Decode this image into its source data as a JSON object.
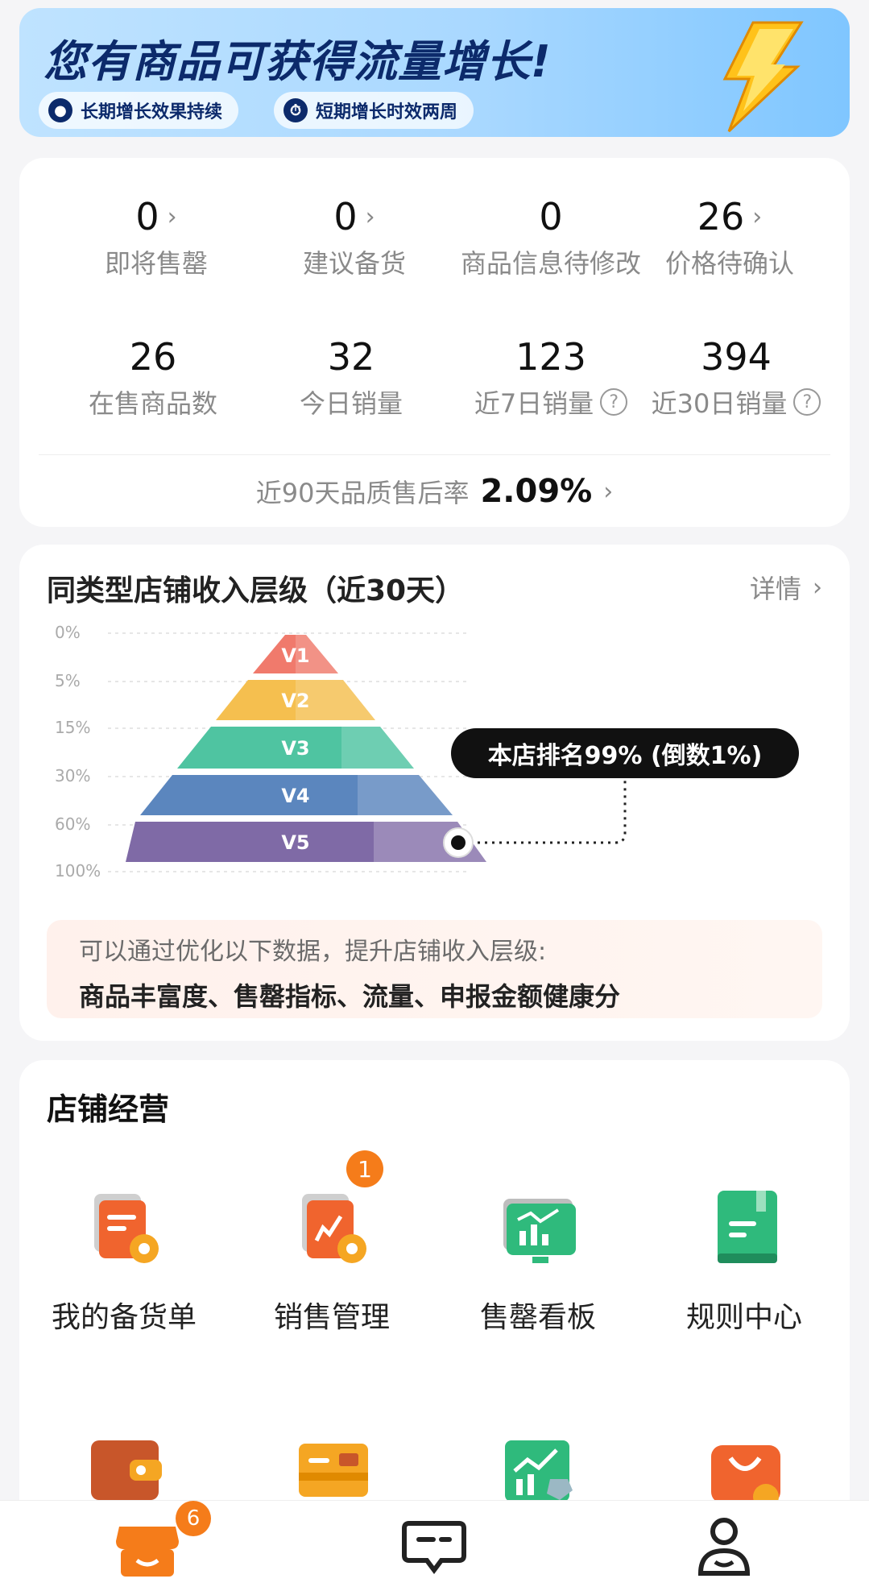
{
  "banner": {
    "title": "您有商品可获得流量增长!",
    "chips": [
      {
        "label": "长期增长效果持续",
        "icon": "globe-icon"
      },
      {
        "label": "短期增长时效两周",
        "icon": "timer-icon"
      }
    ]
  },
  "stats": {
    "row1": [
      {
        "value": "0",
        "label": "即将售罄",
        "has_arrow": true
      },
      {
        "value": "0",
        "label": "建议备货",
        "has_arrow": true
      },
      {
        "value": "0",
        "label": "商品信息待修改",
        "has_arrow": false
      },
      {
        "value": "26",
        "label": "价格待确认",
        "has_arrow": true
      }
    ],
    "row2": [
      {
        "value": "26",
        "label": "在售商品数"
      },
      {
        "value": "32",
        "label": "今日销量"
      },
      {
        "value": "123",
        "label": "近7日销量",
        "help": true
      },
      {
        "value": "394",
        "label": "近30日销量",
        "help": true
      }
    ],
    "after_sale_label": "近90天品质售后率",
    "after_sale_value": "2.09%"
  },
  "pyramid": {
    "title": "同类型店铺收入层级（近30天）",
    "detail_label": "详情",
    "y_labels": [
      "0%",
      "5%",
      "15%",
      "30%",
      "60%",
      "100%"
    ],
    "levels": [
      "V1",
      "V2",
      "V3",
      "V4",
      "V5"
    ],
    "level_colors": [
      "#f07a6c",
      "#f5bf4f",
      "#4fc4a1",
      "#5b86be",
      "#7f6aa6"
    ],
    "tip": "本店排名99% (倒数1%)",
    "hint_line1": "可以通过优化以下数据，提升店铺收入层级:",
    "hint_line2": "商品丰富度、售罄指标、流量、申报金额健康分"
  },
  "operations": {
    "title": "店铺经营",
    "items": [
      {
        "label": "我的备货单",
        "icon": "stock-order-icon"
      },
      {
        "label": "销售管理",
        "icon": "sales-management-icon",
        "badge": "1"
      },
      {
        "label": "售罄看板",
        "icon": "sellout-dashboard-icon"
      },
      {
        "label": "规则中心",
        "icon": "rules-book-icon"
      }
    ],
    "row2_icons": [
      "wallet-icon",
      "card-icon",
      "analytics-icon",
      "shopping-bag-icon"
    ]
  },
  "nav": {
    "items": [
      {
        "icon": "shop-icon",
        "badge": "6"
      },
      {
        "icon": "message-icon"
      },
      {
        "icon": "profile-icon"
      }
    ]
  }
}
